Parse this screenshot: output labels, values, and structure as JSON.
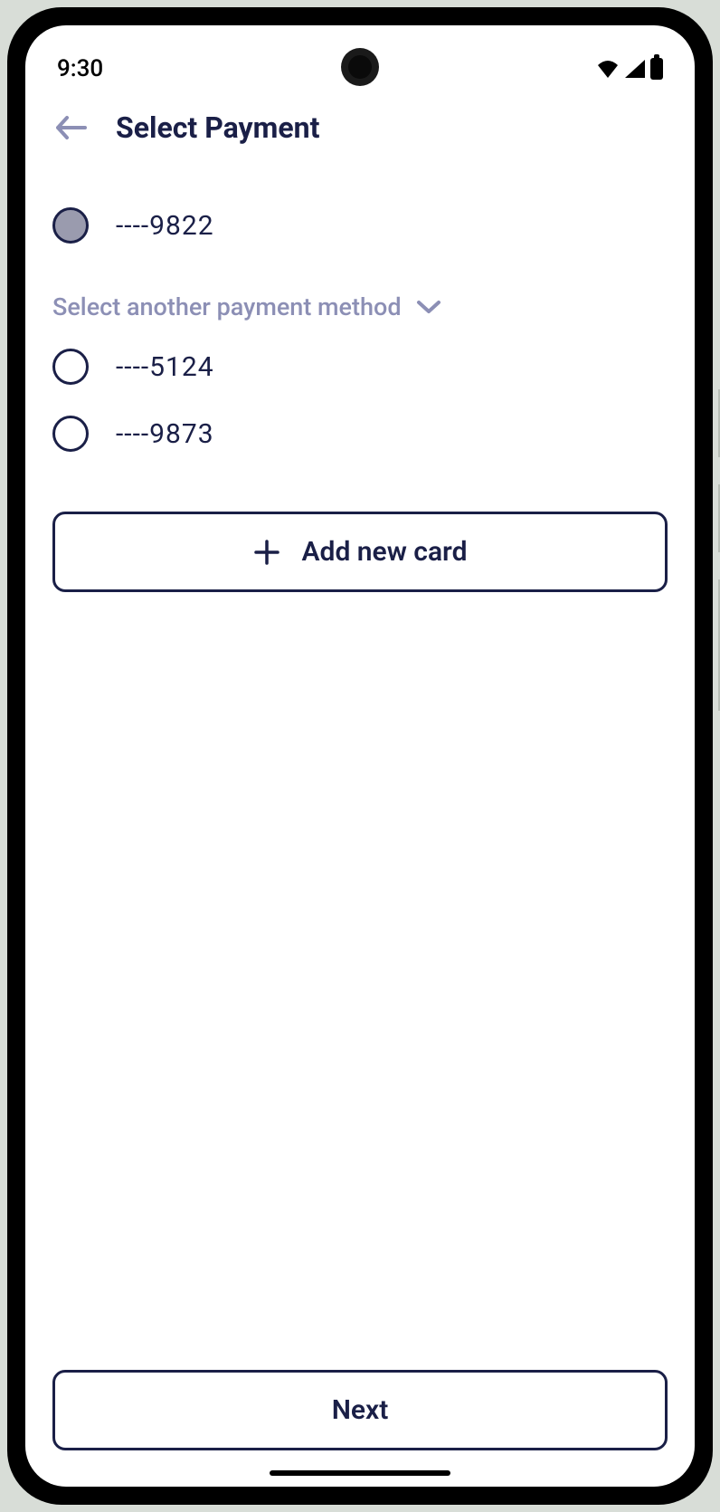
{
  "status_bar": {
    "time": "9:30"
  },
  "header": {
    "title": "Select Payment"
  },
  "payment_methods": {
    "primary": {
      "label": "----9822",
      "selected": true
    },
    "section_header": "Select another payment method",
    "alternatives": [
      {
        "label": "----5124",
        "selected": false
      },
      {
        "label": "----9873",
        "selected": false
      }
    ]
  },
  "actions": {
    "add_card_label": "Add new card",
    "next_button_label": "Next"
  }
}
